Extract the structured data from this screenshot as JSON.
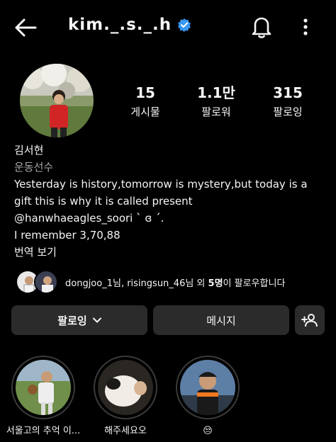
{
  "header": {
    "username": "kim._.s._.h",
    "verified_icon": "verified-badge-icon",
    "back_icon": "back-arrow-icon",
    "notification_icon": "bell-icon",
    "more_icon": "more-vertical-icon"
  },
  "stats": [
    {
      "value": "15",
      "label": "게시물"
    },
    {
      "value": "1.1만",
      "label": "팔로워"
    },
    {
      "value": "315",
      "label": "팔로잉"
    }
  ],
  "bio": {
    "name": "김서현",
    "category": "운동선수",
    "lines": [
      "Yesterday is history,tomorrow is mystery,but today is a",
      "gift this is why it is called present",
      "@hanwhaeagles_soori  ˋ̀ ɞ ˊ́.",
      "I remember 3,70,88",
      "번역 보기"
    ]
  },
  "followed_by": {
    "names": "dongjoo_1님, risingsun_46님 외 ",
    "count": "5명",
    "suffix": "이 팔로우합니다"
  },
  "actions": {
    "following_label": "팔로잉",
    "message_label": "메시지",
    "add_icon": "add-person-icon"
  },
  "highlights": [
    {
      "label": "서울고의 추억 이..."
    },
    {
      "label": "해주세요오"
    },
    {
      "label": "😒"
    }
  ],
  "colors": {
    "background": "#000000",
    "button": "#2b2b2b",
    "verified": "#3897f0",
    "muted_text": "#a8a8a8"
  }
}
